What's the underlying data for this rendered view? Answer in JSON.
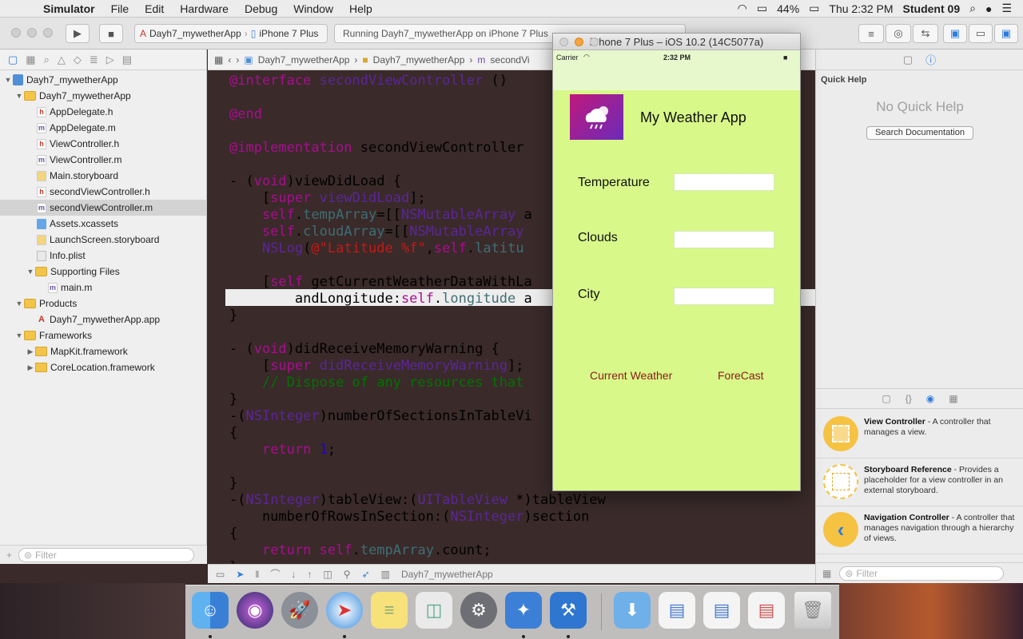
{
  "menubar": {
    "app": "Simulator",
    "items": [
      "File",
      "Edit",
      "Hardware",
      "Debug",
      "Window",
      "Help"
    ],
    "battery": "44%",
    "clock": "Thu 2:32 PM",
    "user": "Student 09"
  },
  "toolbar": {
    "scheme": "Dayh7_mywetherApp",
    "device": "iPhone 7 Plus",
    "activity": "Running Dayh7_mywetherApp on iPhone 7 Plus"
  },
  "navigator": {
    "rows": [
      {
        "label": "Dayh7_mywetherApp",
        "icon": "project-icon"
      },
      {
        "label": "Dayh7_mywetherApp",
        "icon": "folder-icon"
      },
      {
        "label": "AppDelegate.h",
        "icon": "h-file-icon"
      },
      {
        "label": "AppDelegate.m",
        "icon": "m-file-icon"
      },
      {
        "label": "ViewController.h",
        "icon": "h-file-icon"
      },
      {
        "label": "ViewController.m",
        "icon": "m-file-icon"
      },
      {
        "label": "Main.storyboard",
        "icon": "storyboard-icon"
      },
      {
        "label": "secondViewController.h",
        "icon": "h-file-icon"
      },
      {
        "label": "secondViewController.m",
        "icon": "m-file-icon"
      },
      {
        "label": "Assets.xcassets",
        "icon": "assets-icon"
      },
      {
        "label": "LaunchScreen.storyboard",
        "icon": "storyboard-icon"
      },
      {
        "label": "Info.plist",
        "icon": "plist-icon"
      },
      {
        "label": "Supporting Files",
        "icon": "folder-icon"
      },
      {
        "label": "main.m",
        "icon": "m-file-icon"
      },
      {
        "label": "Products",
        "icon": "folder-icon"
      },
      {
        "label": "Dayh7_mywetherApp.app",
        "icon": "app-icon"
      },
      {
        "label": "Frameworks",
        "icon": "folder-icon"
      },
      {
        "label": "MapKit.framework",
        "icon": "framework-icon"
      },
      {
        "label": "CoreLocation.framework",
        "icon": "framework-icon"
      }
    ],
    "filter_placeholder": "Filter"
  },
  "jumpbar": {
    "crumbs": [
      "Dayh7_mywetherApp",
      "Dayh7_mywetherApp",
      "secondVi"
    ]
  },
  "debugbar": {
    "target": "Dayh7_mywetherApp"
  },
  "inspector": {
    "title": "Quick Help",
    "empty": "No Quick Help",
    "search_button": "Search Documentation",
    "library": [
      {
        "name": "View Controller",
        "desc": " - A controller that manages a view."
      },
      {
        "name": "Storyboard Reference",
        "desc": " - Provides a placeholder for a view controller in an external storyboard."
      },
      {
        "name": "Navigation Controller",
        "desc": " - A controller that manages navigation through a hierarchy of views."
      }
    ],
    "filter_placeholder": "Filter"
  },
  "simulator": {
    "title": "iPhone 7 Plus – iOS 10.2 (14C5077a)",
    "carrier": "Carrier",
    "time": "2:32 PM",
    "app_title": "My Weather App",
    "labels": {
      "temperature": "Temperature",
      "clouds": "Clouds",
      "city": "City"
    },
    "buttons": {
      "current": "Current Weather",
      "forecast": "ForeCast"
    }
  },
  "colors": {
    "sim_background": "#d8f88a",
    "button_text": "#8b1a1a",
    "keyword": "#aa0d91"
  }
}
